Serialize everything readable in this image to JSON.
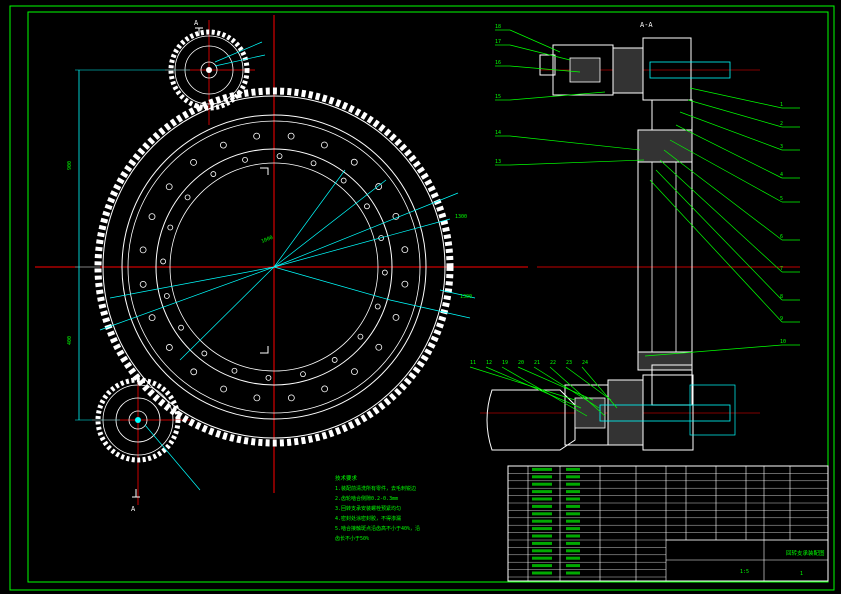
{
  "drawing": {
    "view_labels": [
      "A",
      "A-A"
    ],
    "left_view_labels": [
      "A",
      "A"
    ],
    "section_mark": "A-A",
    "part_numbers_right": [
      "1",
      "2",
      "3",
      "4",
      "5",
      "6",
      "7",
      "8",
      "9",
      "10"
    ],
    "part_numbers_left_top": [
      "18",
      "17",
      "16",
      "15",
      "14",
      "13"
    ],
    "part_numbers_bottom": [
      "11",
      "12",
      "19",
      "20",
      "21",
      "22",
      "23",
      "24"
    ],
    "dim_numbers_main": [
      "900",
      "400",
      "1000",
      "1300",
      "1300"
    ],
    "tech_requirements_title": "技术要求",
    "tech_requirements": [
      "1.装配前清洗所有零件，去毛刺锐边",
      "2.齿轮啮合侧隙0.2-0.3mm",
      "3.回转支承安装螺栓预紧均匀",
      "4.密封处涂密封胶，不得渗漏",
      "5.啮合接触斑点沿齿高不小于40%，沿",
      "齿长不小于50%"
    ]
  },
  "title_block": {
    "drawing_title": "回转支承装配图",
    "scale": "1:5",
    "sheet": "1"
  },
  "colors": {
    "background": "#000000",
    "border": "#00ff00",
    "geometry": "#ffffff",
    "centerline": "#ff0000",
    "leader": "#00ff00",
    "dimension": "#00ffff",
    "text": "#00ff00",
    "magenta": "#ff00ff"
  }
}
